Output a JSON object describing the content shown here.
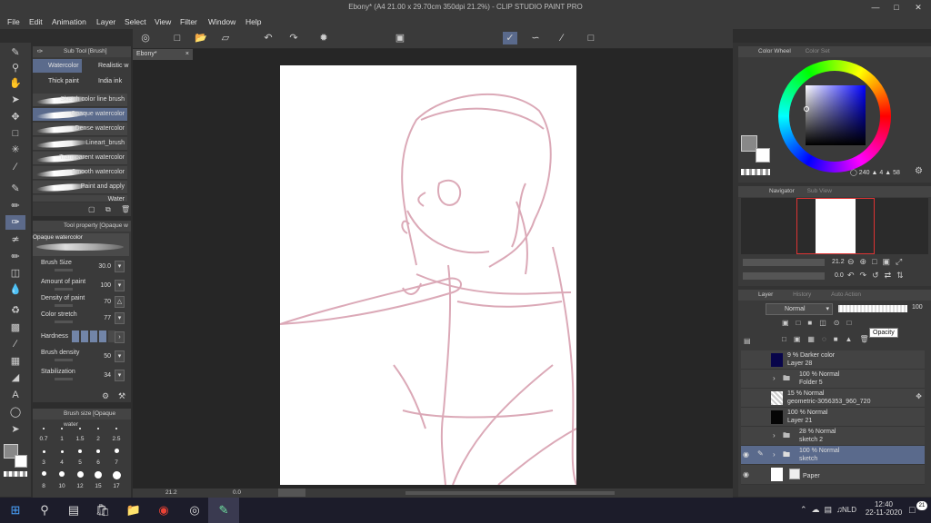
{
  "window": {
    "title": "Ebony* (A4 21.00 x 29.70cm 350dpi 21.2%) - CLIP STUDIO PAINT PRO"
  },
  "menu": [
    "File",
    "Edit",
    "Animation",
    "Layer",
    "Select",
    "View",
    "Filter",
    "Window",
    "Help"
  ],
  "doc_tab": "Ebony*",
  "subtool": {
    "header": "Sub Tool [Brush]",
    "tabs": [
      "Watercolor",
      "Realistic w",
      "Thick paint",
      "India ink"
    ],
    "brushes": [
      "Sketch color line brush",
      "Opaque watercolor",
      "Dense watercolor",
      "Lineart_brush",
      "Transparent watercolor",
      "Smooth watercolor",
      "Paint and apply",
      "Water"
    ],
    "selected": 1
  },
  "toolprop": {
    "header": "Tool property [Opaque w",
    "preview_label": "Opaque watercolor",
    "rows": [
      {
        "label": "Brush Size",
        "value": "30.0"
      },
      {
        "label": "Amount of paint",
        "value": "100"
      },
      {
        "label": "Density of paint",
        "value": "70"
      },
      {
        "label": "Color stretch",
        "value": "77"
      },
      {
        "label": "Hardness",
        "value": ""
      },
      {
        "label": "Brush density",
        "value": "50"
      },
      {
        "label": "Stabilization",
        "value": "34"
      }
    ]
  },
  "brushsize": {
    "header": "Brush size [Opaque water",
    "values": [
      "0.7",
      "1",
      "1.5",
      "2",
      "2.5",
      "3",
      "4",
      "5",
      "6",
      "7",
      "8",
      "10",
      "12",
      "15",
      "17"
    ]
  },
  "colorwheel": {
    "tabs": [
      "Color Wheel",
      "Color Set"
    ],
    "readout": [
      "240",
      "4",
      "58"
    ]
  },
  "navigator": {
    "tabs": [
      "Navigator",
      "Sub View"
    ],
    "zoom": "21.2",
    "angle": "0.0"
  },
  "layers": {
    "tabs": [
      "Layer",
      "History",
      "Auto Action"
    ],
    "blend": "Normal",
    "opacity": "100",
    "tooltip": "Opacity",
    "rows": [
      {
        "mode": "9 % Darker color",
        "name": "Layer 28",
        "thumb": "dark",
        "folder": false
      },
      {
        "mode": "100 % Normal",
        "name": "Folder 5",
        "thumb": "",
        "folder": true
      },
      {
        "mode": "15 % Normal",
        "name": "geometric-3056353_960_720",
        "thumb": "check",
        "folder": false
      },
      {
        "mode": "100 % Normal",
        "name": "Layer 21",
        "thumb": "black",
        "folder": false
      },
      {
        "mode": "28 % Normal",
        "name": "sketch 2",
        "thumb": "",
        "folder": true
      },
      {
        "mode": "100 % Normal",
        "name": "sketch",
        "thumb": "",
        "folder": true
      },
      {
        "mode": "",
        "name": "Paper",
        "thumb": "white",
        "folder": false
      }
    ],
    "selected": 5
  },
  "status": {
    "zoom": "21.2",
    "angle": "0.0"
  },
  "taskbar": {
    "lang": "NLD",
    "time": "12:40",
    "date": "22-11-2020",
    "badge": "21"
  }
}
